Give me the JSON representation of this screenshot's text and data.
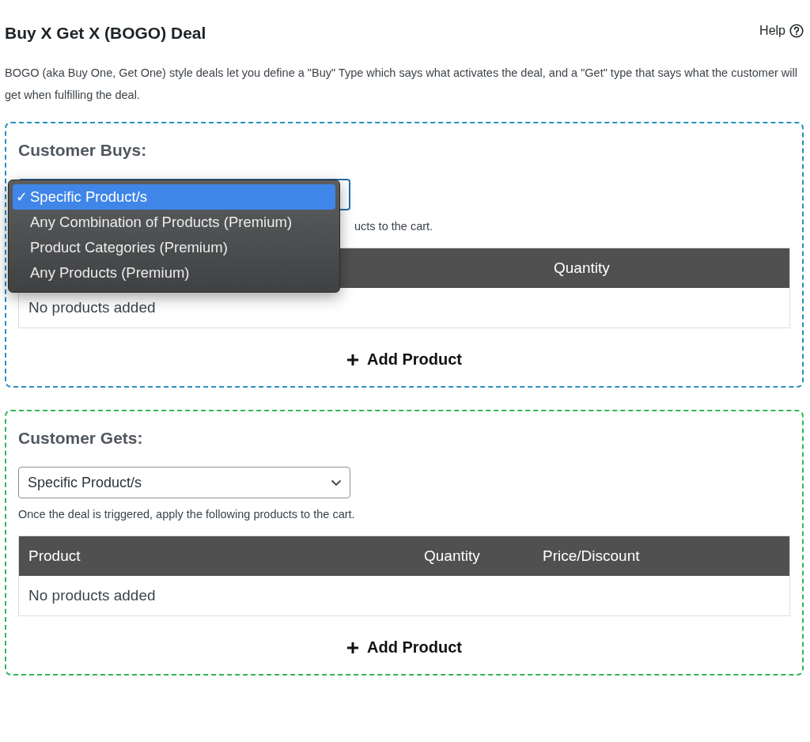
{
  "title": "Buy X Get X (BOGO) Deal",
  "help": {
    "label": "Help"
  },
  "description": "BOGO (aka Buy One, Get One) style deals let you define a \"Buy\" Type which says what activates the deal, and a \"Get\" type that says what the customer will get when fulfilling the deal.",
  "buys": {
    "heading": "Customer Buys:",
    "select": {
      "focused": true
    },
    "menu": {
      "check_mark": "✓",
      "items": [
        {
          "label": "Specific Product/s",
          "selected": true
        },
        {
          "label": "Any Combination of Products (Premium)",
          "selected": false
        },
        {
          "label": "Product Categories (Premium)",
          "selected": false
        },
        {
          "label": "Any Products (Premium)",
          "selected": false
        }
      ]
    },
    "hint": "ucts to the cart.",
    "table": {
      "columns": [
        "Quantity"
      ],
      "empty": "No products added"
    },
    "add_button": "Add Product"
  },
  "gets": {
    "heading": "Customer Gets:",
    "select": {
      "value": "Specific Product/s",
      "focused": false
    },
    "hint": "Once the deal is triggered, apply the following products to the cart.",
    "table": {
      "columns": [
        "Product",
        "Quantity",
        "Price/Discount"
      ],
      "empty": "No products added"
    },
    "add_button": "Add Product"
  }
}
